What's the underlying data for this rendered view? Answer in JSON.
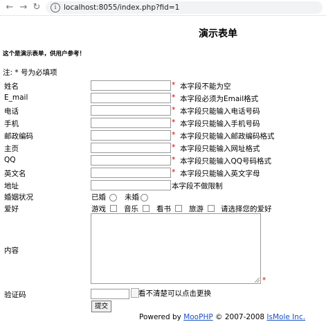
{
  "browser": {
    "url": "localhost:8055/index.php?fid=1"
  },
  "page": {
    "title": "演示表单",
    "description": "这个是演示表单，供用户参考！",
    "note": "注: * 号为必填项"
  },
  "fields": [
    {
      "label": "姓名",
      "hint": "本字段不能为空",
      "required": true
    },
    {
      "label": "E_mail",
      "hint": "本字段必须为Email格式",
      "required": true
    },
    {
      "label": "电话",
      "hint": "本字段只能输入电话号码",
      "required": true
    },
    {
      "label": "手机",
      "hint": "本字段只能输入手机号码",
      "required": true
    },
    {
      "label": "邮政编码",
      "hint": "本字段只能输入邮政编码格式",
      "required": true
    },
    {
      "label": "主页",
      "hint": "本字段只能输入网址格式",
      "required": true
    },
    {
      "label": "QQ",
      "hint": "本字段只能输入QQ号码格式",
      "required": true
    },
    {
      "label": "英文名",
      "hint": "本字段只能输入英文字母",
      "required": true
    },
    {
      "label": "地址",
      "hint": "本字段不做限制",
      "required": false
    }
  ],
  "marital": {
    "label": "婚姻状况",
    "options": [
      "已婚",
      "未婚"
    ]
  },
  "hobbies": {
    "label": "爱好",
    "options": [
      "游戏",
      "音乐",
      "看书",
      "旅游"
    ],
    "hint": "请选择您的爱好"
  },
  "content": {
    "label": "内容",
    "star": "*"
  },
  "captcha": {
    "label": "验证码",
    "alt": "看不清楚可以点击更换"
  },
  "star": "*",
  "submit_label": "提交",
  "footer": {
    "prefix": "Powered by ",
    "link1": "MooPHP",
    "middle": " © 2007-2008 ",
    "link2": "IsMole Inc."
  }
}
